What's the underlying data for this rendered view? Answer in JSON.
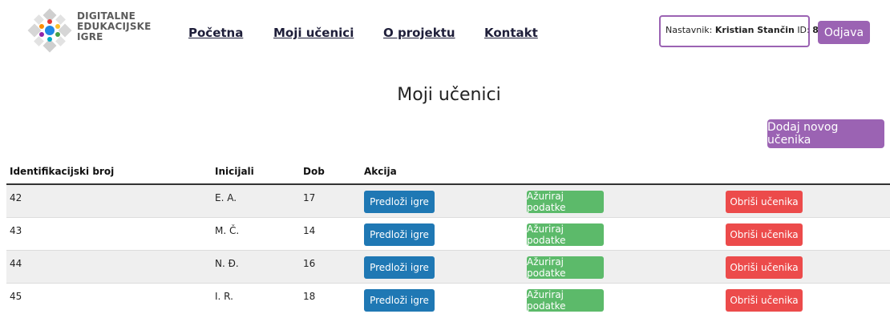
{
  "header": {
    "logo_lines": [
      "DIGITALNE",
      "EDUKACIJSKE",
      "IGRE"
    ],
    "nav": [
      "Početna",
      "Moji učenici",
      "O projektu",
      "Kontakt"
    ],
    "teacher": {
      "label": "Nastavnik:",
      "name": "Kristian Stančin",
      "id_label": "ID:",
      "id": "8"
    },
    "logout_label": "Odjava"
  },
  "main": {
    "title": "Moji učenici",
    "add_button": "Dodaj novog učenika"
  },
  "table": {
    "columns": [
      "Identifikacijski broj",
      "Inicijali",
      "Dob",
      "Akcija"
    ],
    "rows": [
      {
        "id": "42",
        "initials": "E. A.",
        "age": "17"
      },
      {
        "id": "43",
        "initials": "M. Č.",
        "age": "14"
      },
      {
        "id": "44",
        "initials": "N. Đ.",
        "age": "16"
      },
      {
        "id": "45",
        "initials": "I. R.",
        "age": "18"
      }
    ],
    "actions": {
      "suggest": "Predloži igre",
      "update": "Ažuriraj podatke",
      "delete": "Obriši učenika"
    }
  },
  "colors": {
    "accent_purple": "#9b63b3",
    "button_blue": "#1f78b4",
    "button_green": "#5cba6a",
    "button_red": "#ec4b4b"
  },
  "icons": {
    "logo": "colorful-diamond-dots-logo"
  }
}
